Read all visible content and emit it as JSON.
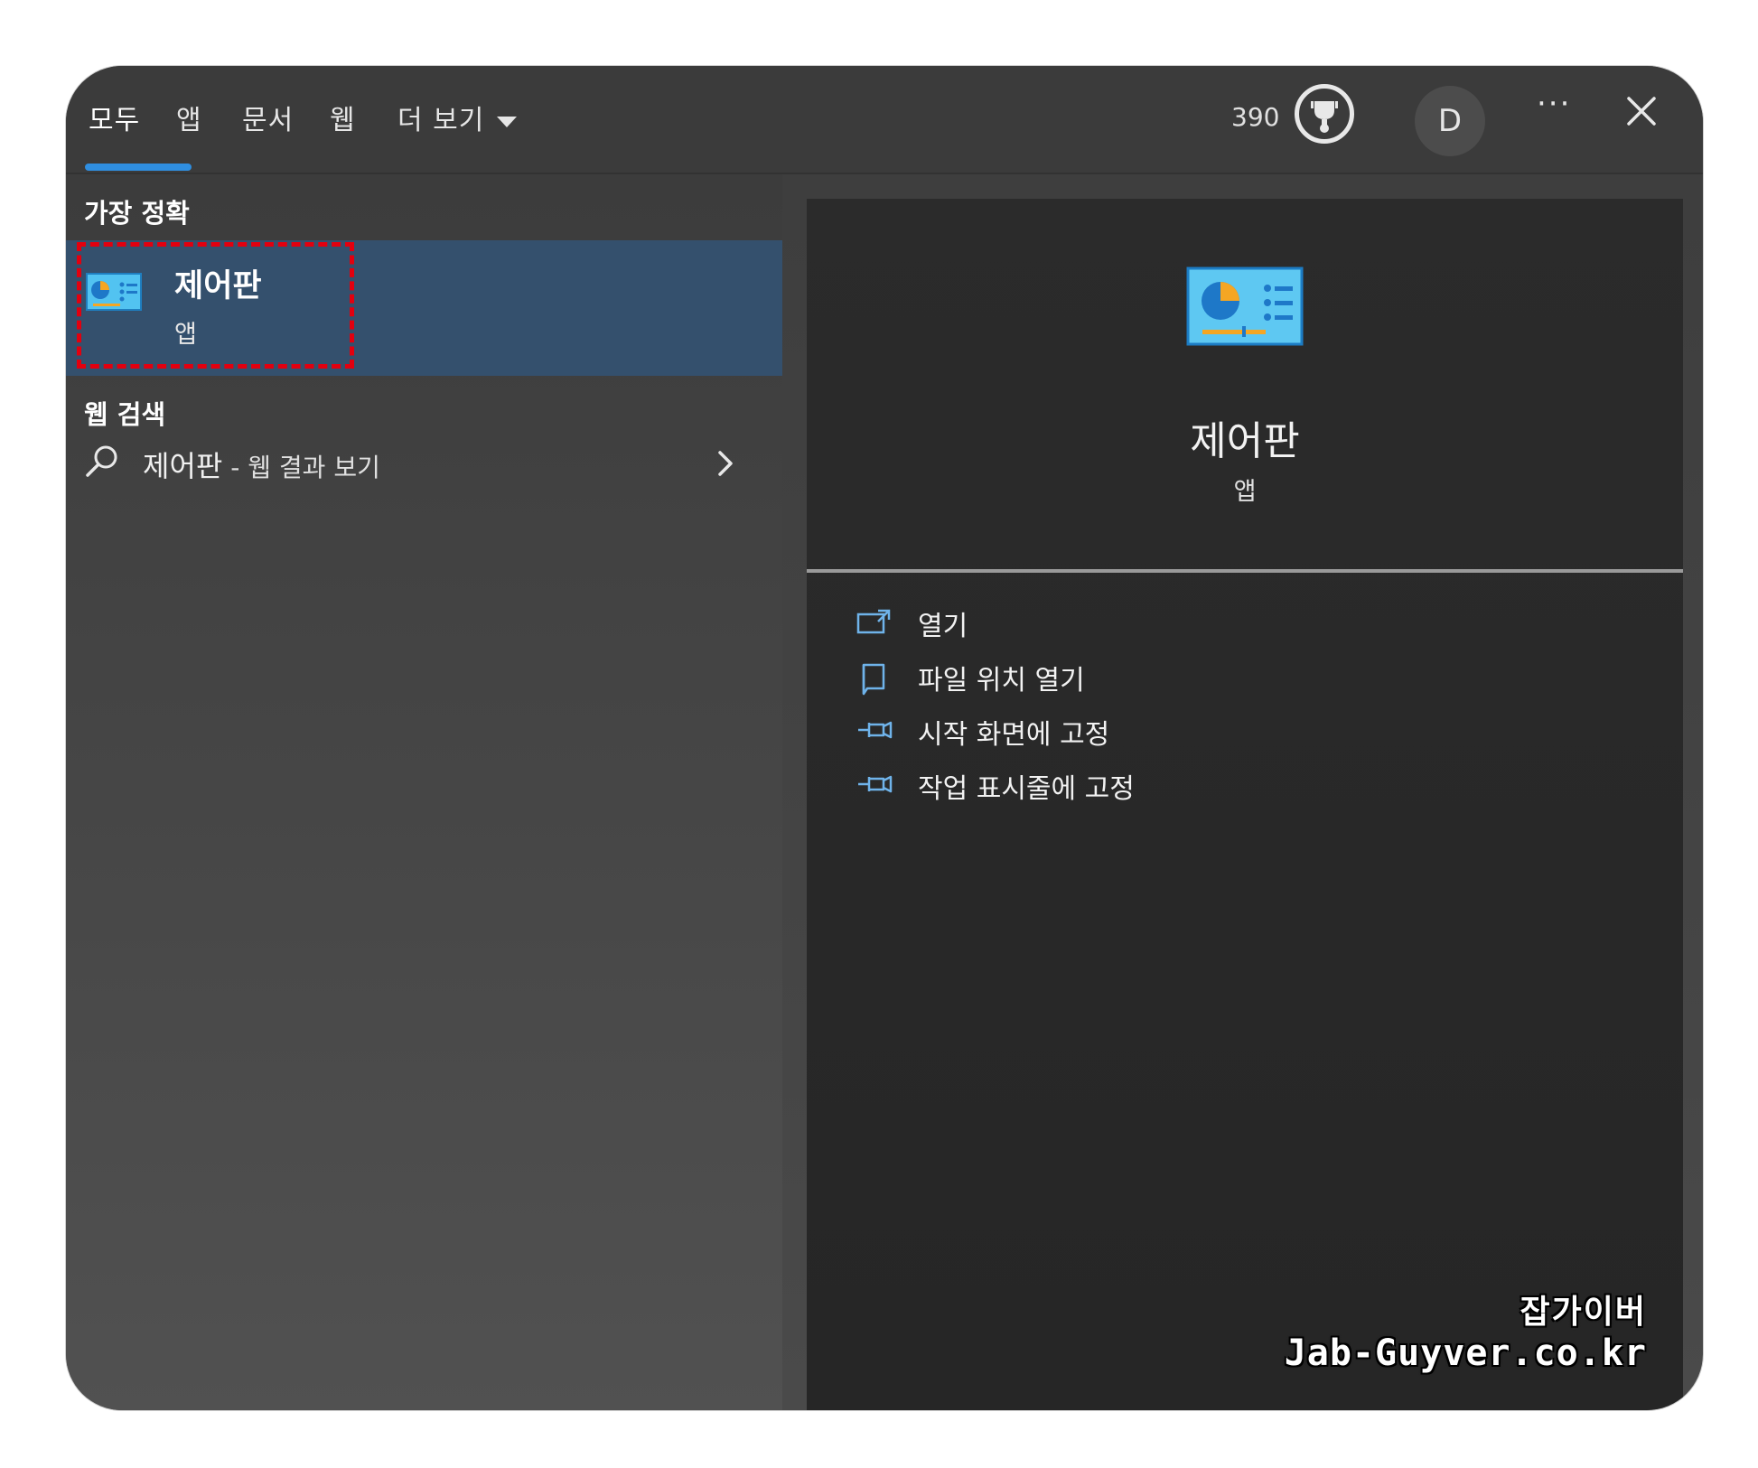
{
  "tabs": [
    {
      "label": "모두"
    },
    {
      "label": "앱"
    },
    {
      "label": "문서"
    },
    {
      "label": "웹"
    },
    {
      "label": "더 보기"
    }
  ],
  "header": {
    "points": "390",
    "avatar_initial": "D",
    "more_label": "···"
  },
  "left": {
    "best_match_label": "가장 정확",
    "best_match": {
      "title": "제어판",
      "subtitle": "앱"
    },
    "web_search_label": "웹 검색",
    "web_search": {
      "query": "제어판",
      "suffix": " - 웹 결과 보기"
    }
  },
  "right": {
    "title": "제어판",
    "subtitle": "앱",
    "actions": [
      {
        "label": "열기",
        "icon": "open-icon"
      },
      {
        "label": "파일 위치 열기",
        "icon": "file-location-icon"
      },
      {
        "label": "시작 화면에 고정",
        "icon": "pin-icon"
      },
      {
        "label": "작업 표시줄에 고정",
        "icon": "pin-icon"
      }
    ]
  },
  "watermark": {
    "line1": "잡가이버",
    "line2": "Jab-Guyver.co.kr"
  },
  "colors": {
    "accent": "#2f8ee0",
    "selection": "#34506d",
    "highlight_box": "#e2000f"
  }
}
